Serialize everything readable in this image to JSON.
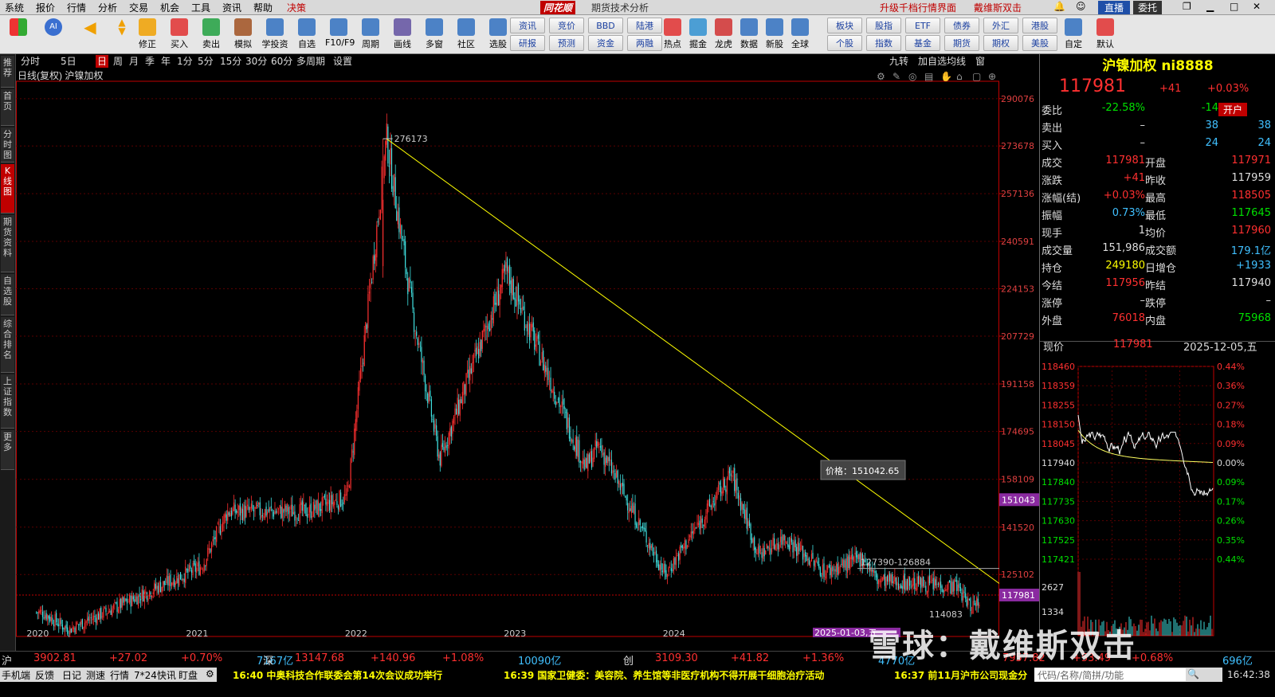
{
  "menu": {
    "items": [
      "系统",
      "报价",
      "行情",
      "分析",
      "交易",
      "机会",
      "工具",
      "资讯",
      "帮助",
      "决策"
    ],
    "brand": "同花顺",
    "subtitle": "期货技术分析",
    "upgrade": "升级千档行情界面",
    "watermark_user": "戴维斯双击",
    "live": "直播",
    "weituo": "委托"
  },
  "toolbar": {
    "buttons": [
      "修正",
      "买入",
      "卖出",
      "模拟",
      "学投资",
      "自选",
      "F10/F9",
      "周期",
      "画线",
      "多窗",
      "社区",
      "选股"
    ],
    "quick": [
      [
        "资讯",
        "竞价",
        "BBD",
        "陆港"
      ],
      [
        "研报",
        "预测",
        "资金",
        "两融"
      ]
    ],
    "buttons2": [
      "热点",
      "掘金",
      "龙虎",
      "数据",
      "新股",
      "全球"
    ],
    "quick2": [
      [
        "板块",
        "股指",
        "ETF",
        "债券",
        "外汇",
        "港股"
      ],
      [
        "个股",
        "指数",
        "基金",
        "期货",
        "期权",
        "美股"
      ]
    ],
    "buttons3": [
      "自定",
      "默认"
    ]
  },
  "periods": [
    "分时",
    "5日",
    "日",
    "周",
    "月",
    "季",
    "年",
    "1分",
    "5分",
    "15分",
    "30分",
    "60分",
    "多周期",
    "设置"
  ],
  "period_selected": "日",
  "period_right": [
    "九转",
    "加自选",
    "均线",
    "窗"
  ],
  "leftbar": [
    "推荐",
    "首页",
    "分时图",
    "K线图",
    "期货资料",
    "自选股",
    "综合排名",
    "上证指数",
    "更多"
  ],
  "leftbar_selected": "K线图",
  "chart": {
    "header": "日线(复权)  沪镍加权",
    "peak_label": "276173",
    "low_label": "114083",
    "range_label": "127390-126884",
    "tooltip": "价格：151042.65",
    "date_tip": "2025-01-03,五",
    "x_labels": [
      "2020",
      "2021",
      "2022",
      "2023",
      "2024"
    ],
    "y_labels": [
      "290076",
      "273678",
      "257136",
      "240591",
      "224153",
      "207729",
      "191158",
      "174695",
      "158109",
      "141520",
      "125102"
    ],
    "price_tag": "151043",
    "last_tag": "117981",
    "colors": {
      "up": "#ff3030",
      "down": "#40e0e0",
      "trend": "#ffff00",
      "axis": "#c00000"
    }
  },
  "chart_data": {
    "type": "candlestick",
    "title": "日线(复权) 沪镍加权",
    "ylim": [
      105000,
      295000
    ],
    "trendline": {
      "from": [
        "2022-03",
        276173
      ],
      "to": [
        "2025-12",
        122000
      ]
    },
    "key_points": [
      {
        "date": "2020-01",
        "close": 112000
      },
      {
        "date": "2020-03",
        "close": 106000
      },
      {
        "date": "2021-01",
        "close": 128000
      },
      {
        "date": "2021-03",
        "close": 147000
      },
      {
        "date": "2021-09",
        "close": 147000
      },
      {
        "date": "2021-12",
        "close": 152000
      },
      {
        "date": "2022-03",
        "close": 276173
      },
      {
        "date": "2022-05",
        "close": 215000
      },
      {
        "date": "2022-07",
        "close": 165000
      },
      {
        "date": "2022-12",
        "close": 230000
      },
      {
        "date": "2023-04",
        "close": 185000
      },
      {
        "date": "2023-06",
        "close": 162000
      },
      {
        "date": "2023-07",
        "close": 170000
      },
      {
        "date": "2023-12",
        "close": 125000
      },
      {
        "date": "2024-05",
        "close": 160000
      },
      {
        "date": "2024-07",
        "close": 132000
      },
      {
        "date": "2024-09",
        "close": 138000
      },
      {
        "date": "2024-12",
        "close": 126000
      },
      {
        "date": "2025-03",
        "close": 131000
      },
      {
        "date": "2025-04",
        "close": 123000
      },
      {
        "date": "2025-10",
        "close": 121000
      },
      {
        "date": "2025-11",
        "close": 114083
      },
      {
        "date": "2025-12",
        "close": 117981
      }
    ]
  },
  "quote": {
    "title": "沪镍加权  ni8888",
    "price": "117981",
    "change": "+41",
    "pct": "+0.03%",
    "rows": [
      {
        "k": "委比",
        "v1": "-22.58%",
        "v2": "-14",
        "c1": "#00e000",
        "c2": "#00e000",
        "badge": "开户"
      },
      {
        "k": "卖出",
        "v1": "–",
        "v2": "38",
        "c1": "#ddd",
        "c2": "#40c0ff"
      },
      {
        "k": "买入",
        "v1": "–",
        "v2": "24",
        "c1": "#ddd",
        "c2": "#40c0ff"
      },
      {
        "k": "成交",
        "v1": "117981",
        "k2": "开盘",
        "v2": "117971",
        "c1": "#ff3030",
        "c2": "#ff3030"
      },
      {
        "k": "涨跌",
        "v1": "+41",
        "k2": "昨收",
        "v2": "117959",
        "c1": "#ff3030",
        "c2": "#ddd"
      },
      {
        "k": "涨幅(结)",
        "v1": "+0.03%",
        "k2": "最高",
        "v2": "118505",
        "c1": "#ff3030",
        "c2": "#ff3030"
      },
      {
        "k": "振幅",
        "v1": "0.73%",
        "k2": "最低",
        "v2": "117645",
        "c1": "#40c0ff",
        "c2": "#00e000"
      },
      {
        "k": "现手",
        "v1": "1",
        "k2": "均价",
        "v2": "117960",
        "c1": "#ddd",
        "c2": "#ff3030"
      },
      {
        "k": "成交量",
        "v1": "151,986",
        "k2": "成交额",
        "v2": "179.1亿",
        "c1": "#ddd",
        "c2": "#40c0ff"
      },
      {
        "k": "持仓",
        "v1": "249180",
        "k2": "日增仓",
        "v2": "+1933",
        "c1": "#ffff00",
        "c2": "#40c0ff"
      },
      {
        "k": "今结",
        "v1": "117956",
        "k2": "昨结",
        "v2": "117940",
        "c1": "#ff3030",
        "c2": "#ddd"
      },
      {
        "k": "涨停",
        "v1": "–",
        "k2": "跌停",
        "v2": "–",
        "c1": "#ddd",
        "c2": "#ddd"
      },
      {
        "k": "外盘",
        "v1": "76018",
        "k2": "内盘",
        "v2": "75968",
        "c1": "#ff3030",
        "c2": "#00e000"
      }
    ],
    "mini_header": {
      "label": "现价",
      "price": "117981",
      "date": "2025-12-05,五"
    },
    "mini_left": [
      "118460",
      "118359",
      "118255",
      "118150",
      "118045",
      "117940",
      "117840",
      "117735",
      "117630",
      "117525",
      "117421",
      "2627",
      "1334"
    ],
    "mini_right": [
      "0.44%",
      "0.36%",
      "0.27%",
      "0.18%",
      "0.09%",
      "0.00%",
      "0.09%",
      "0.17%",
      "0.26%",
      "0.35%",
      "0.44%"
    ]
  },
  "indexbar": [
    {
      "name": "沪",
      "v": "3902.81",
      "c": "+27.02",
      "p": "+0.70%",
      "amt": "7167亿"
    },
    {
      "name": "深",
      "v": "13147.68",
      "c": "+140.96",
      "p": "+1.08%",
      "amt": "10090亿"
    },
    {
      "name": "创",
      "v": "3109.30",
      "c": "+41.82",
      "p": "+1.36%",
      "amt": "4770亿"
    },
    {
      "name": "中小板指",
      "v": "7957.82",
      "c": "+53.49",
      "p": "+0.68%",
      "amt": "696亿"
    }
  ],
  "status": {
    "left": [
      "手机端",
      "反馈",
      "日记",
      "测速",
      "行情",
      "7*24快讯",
      "盯盘"
    ],
    "news": [
      "16:40 中奥科技合作联委会第14次会议成功举行",
      "16:39 国家卫健委：美容院、养生馆等非医疗机构不得开展干细胞治疗活动",
      "16:37 前11月沪市公司现金分"
    ],
    "search": "代码/名称/简拼/功能",
    "time": "16:42:38"
  },
  "watermark": "雪球：戴维斯双击"
}
